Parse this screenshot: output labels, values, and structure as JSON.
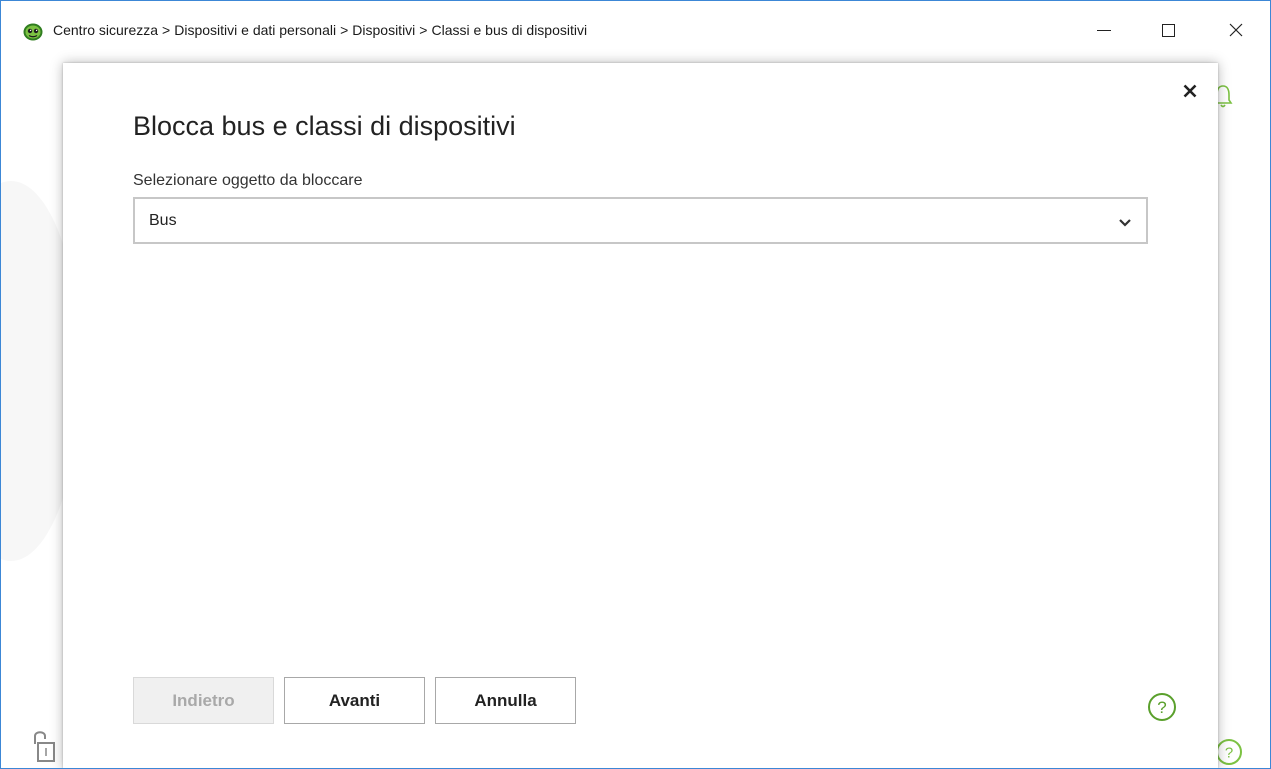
{
  "window": {
    "breadcrumb": [
      "Centro sicurezza",
      "Dispositivi e dati personali",
      "Dispositivi",
      "Classi e bus di dispositivi"
    ],
    "breadcrumb_separator": ">"
  },
  "dialog": {
    "title": "Blocca bus e classi di dispositivi",
    "field_label": "Selezionare oggetto da bloccare",
    "select_value": "Bus",
    "buttons": {
      "back": "Indietro",
      "next": "Avanti",
      "cancel": "Annulla"
    }
  },
  "colors": {
    "accent_green": "#5aa02c",
    "window_border": "#3c87d6",
    "disabled_text": "#a9a9a9"
  },
  "icons": {
    "app": "dr-web-spider-icon",
    "help": "help-circle-icon",
    "close": "close-icon",
    "chevron": "chevron-down-icon"
  }
}
